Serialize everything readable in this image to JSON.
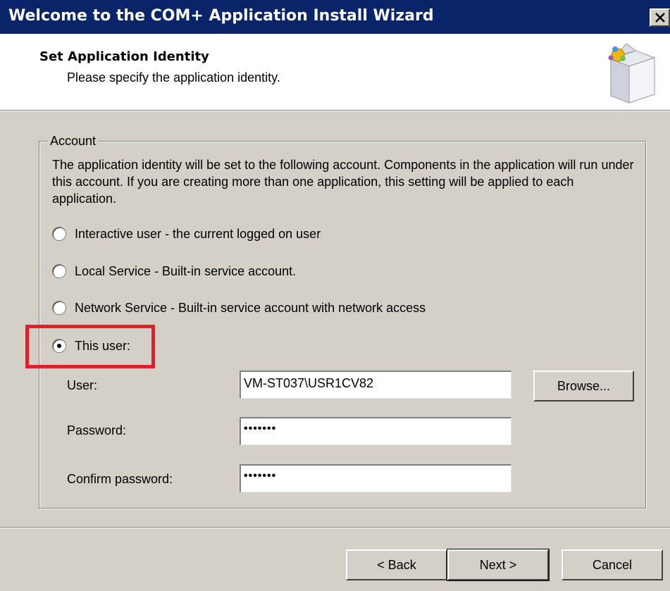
{
  "window": {
    "title": "Welcome to the COM+ Application Install Wizard"
  },
  "header": {
    "title": "Set Application Identity",
    "subtitle": "Please specify the application identity."
  },
  "account": {
    "legend": "Account",
    "description": "The application identity will be set to the following account.  Components in the application will run under this account.  If you are creating more than one application, this setting will be applied to each application.",
    "options": [
      {
        "label": "Interactive user - the current logged on user",
        "selected": false
      },
      {
        "label": "Local Service - Built-in service account.",
        "selected": false
      },
      {
        "label": "Network Service - Built-in service account with network access",
        "selected": false
      },
      {
        "label": "This user:",
        "selected": true
      }
    ],
    "user_label": "User:",
    "user_value": "VM-ST037\\USR1CV82",
    "password_label": "Password:",
    "password_value": "•••••••",
    "confirm_label": "Confirm password:",
    "confirm_value": "•••••••",
    "browse_label": "Browse..."
  },
  "buttons": {
    "back": "< Back",
    "next": "Next >",
    "cancel": "Cancel"
  },
  "colors": {
    "titlebar": "#0a246a",
    "highlight": "#e0202a",
    "dialog": "#d4d0c8"
  }
}
